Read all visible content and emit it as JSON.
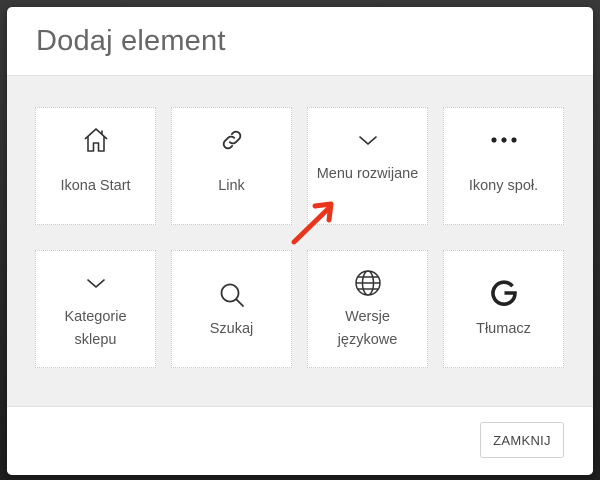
{
  "dialog": {
    "title": "Dodaj element",
    "close_label": "ZAMKNIJ"
  },
  "tiles": [
    {
      "label": "Ikona Start",
      "icon": "home-icon"
    },
    {
      "label": "Link",
      "icon": "link-icon"
    },
    {
      "label": "Menu rozwijane",
      "icon": "chevron-down-icon"
    },
    {
      "label": "Ikony społ.",
      "icon": "more-horizontal-icon"
    },
    {
      "label": "Kategorie sklepu",
      "icon": "chevron-down-icon"
    },
    {
      "label": "Szukaj",
      "icon": "search-icon"
    },
    {
      "label": "Wersje językowe",
      "icon": "globe-icon"
    },
    {
      "label": "Tłumacz",
      "icon": "google-icon"
    }
  ],
  "colors": {
    "annotation_arrow": "#e8351c",
    "modal_body_bg": "#f0f0f0",
    "title_text": "#666666"
  }
}
